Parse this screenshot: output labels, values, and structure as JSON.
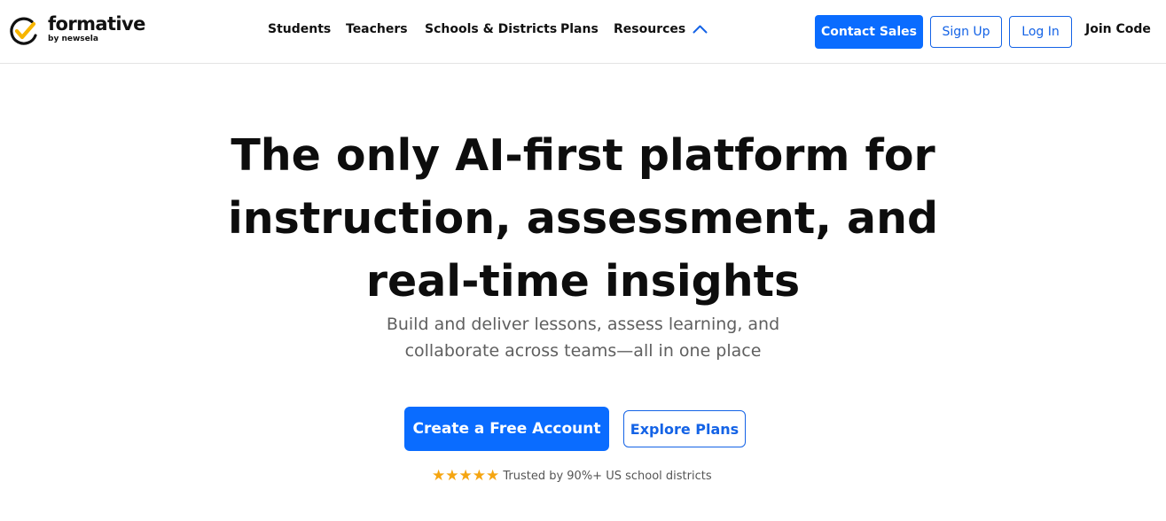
{
  "brand": {
    "name": "formative",
    "byline": "by newsela",
    "accent_color": "#f7b500"
  },
  "nav": {
    "items": [
      "Students",
      "Teachers",
      "Schools & Districts",
      "Plans",
      "Resources"
    ],
    "resources_icon": "chevron-up-icon"
  },
  "header_actions": {
    "contact_sales": "Contact Sales",
    "sign_up": "Sign Up",
    "log_in": "Log In",
    "join_code": "Join Code"
  },
  "hero": {
    "title_lines": [
      "The only AI-first platform for",
      "instruction, assessment, and",
      "real-time insights"
    ],
    "subtitle_lines": [
      "Build and deliver lessons, assess learning, and",
      "collaborate across teams—all in one place"
    ],
    "primary_cta": "Create a Free Account",
    "secondary_cta": "Explore Plans",
    "stars": "★★★★★",
    "trust_text": "Trusted by 90%+ US school districts"
  },
  "colors": {
    "primary": "#0a6cff",
    "outline": "#1463e6",
    "star": "#f5a511"
  }
}
